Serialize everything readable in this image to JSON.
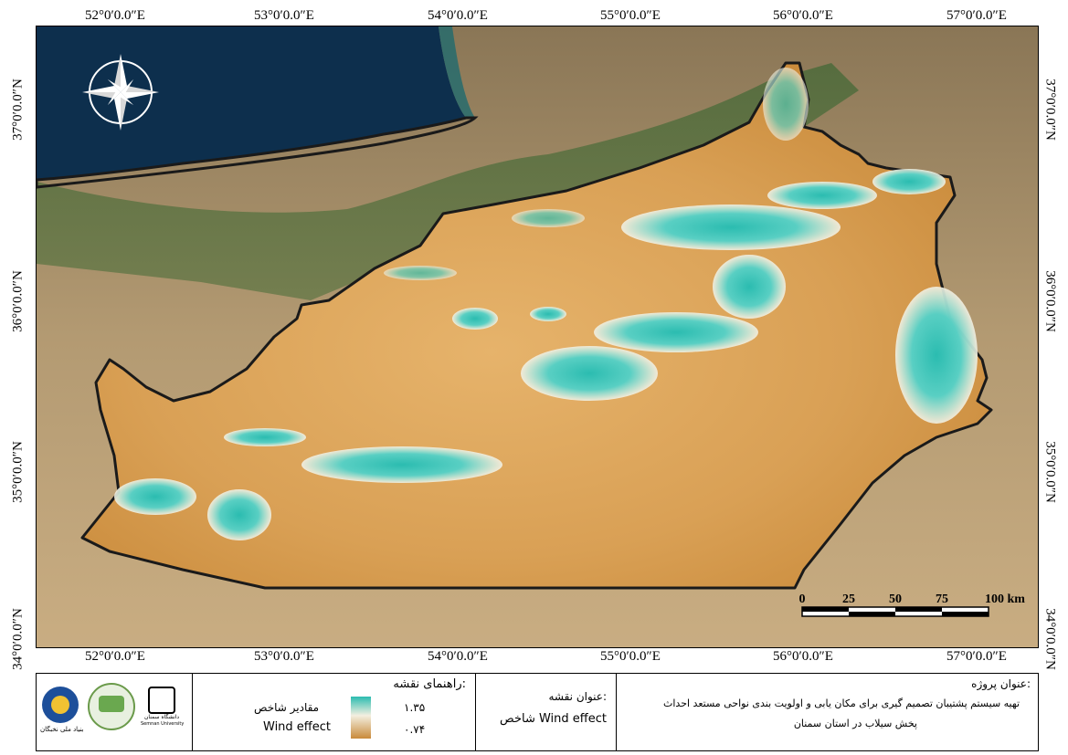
{
  "map": {
    "top_labels": [
      "52°0′0.0″E",
      "53°0′0.0″E",
      "54°0′0.0″E",
      "55°0′0.0″E",
      "56°0′0.0″E",
      "57°0′0.0″E"
    ],
    "bottom_labels": [
      "52°0′0.0″E",
      "53°0′0.0″E",
      "54°0′0.0″E",
      "55°0′0.0″E",
      "56°0′0.0″E",
      "57°0′0.0″E"
    ],
    "left_labels": [
      "37°0′0.0″N",
      "36°0′0.0″N",
      "35°0′0.0″N",
      "34°0′0.0″N"
    ],
    "right_labels": [
      "37°0′0.0″N",
      "36°0′0.0″N",
      "35°0′0.0″N",
      "34°0′0.0″N"
    ],
    "north_arrow_icon": "compass-rose-icon",
    "scale_bar": {
      "ticks": [
        "0",
        "25",
        "50",
        "75",
        "100 km"
      ]
    },
    "colors": {
      "high": "#2bbcb0",
      "low": "#c98a3a",
      "sea": "#0d2f4d",
      "boundary": "#1a1a1a"
    }
  },
  "legend": {
    "logos": [
      "بنیاد ملی نخبگان",
      "دانشگاه سمنان",
      "Semnan University"
    ],
    "map_legend_title": "راهنمای نقشه:",
    "index_values_label": "مقادیر شاخص",
    "index_name": "Wind effect",
    "max_value": "۱.۳۵",
    "min_value": "۰.۷۴",
    "map_title_heading": "عنوان نقشه:",
    "map_title_value": "شاخص Wind effect",
    "project_title_heading": "عنوان پروژه:",
    "project_title_line1": "تهیه سیستم پشتیبان تصمیم گیری برای مکان یابی و اولویت بندی نواحی مستعد احداث",
    "project_title_line2": "پخش سیلاب در استان سمنان"
  }
}
